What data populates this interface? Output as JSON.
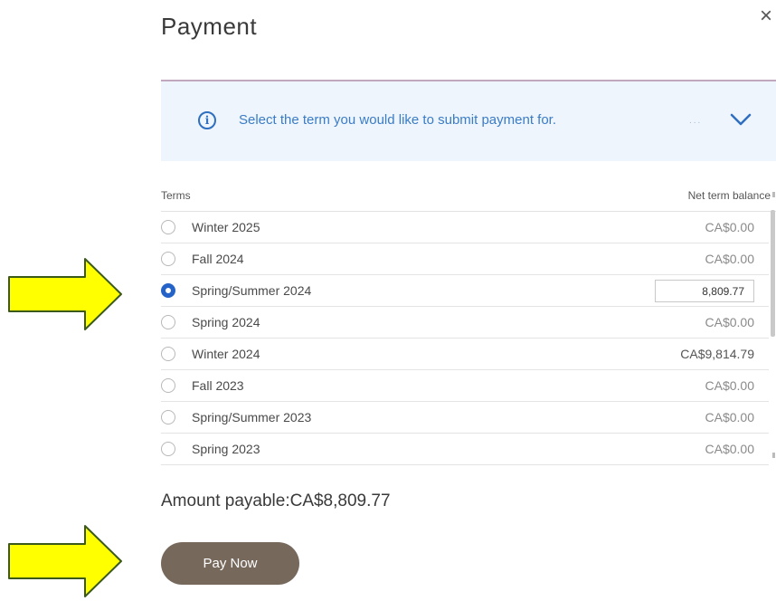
{
  "dialog": {
    "title": "Payment",
    "close_label": "×"
  },
  "info": {
    "message": "Select the term you would like to submit payment for.",
    "dots": "...",
    "icon": "info-circle-icon"
  },
  "table": {
    "headers": {
      "terms": "Terms",
      "balance": "Net term balance"
    },
    "rows": [
      {
        "term": "Winter 2025",
        "balance": "CA$0.00",
        "selected": false
      },
      {
        "term": "Fall 2024",
        "balance": "CA$0.00",
        "selected": false
      },
      {
        "term": "Spring/Summer 2024",
        "balance": "",
        "input_value": "8,809.77",
        "selected": true
      },
      {
        "term": "Spring 2024",
        "balance": "CA$0.00",
        "selected": false
      },
      {
        "term": "Winter 2024",
        "balance": "CA$9,814.79",
        "selected": false
      },
      {
        "term": "Fall 2023",
        "balance": "CA$0.00",
        "selected": false
      },
      {
        "term": "Spring/Summer 2023",
        "balance": "CA$0.00",
        "selected": false
      },
      {
        "term": "Spring 2023",
        "balance": "CA$0.00",
        "selected": false
      }
    ]
  },
  "summary": {
    "amount_payable": "Amount payable:CA$8,809.77"
  },
  "actions": {
    "pay_now": "Pay Now"
  },
  "colors": {
    "accent_blue": "#2563c9",
    "info_bg": "#eef5fc",
    "button_bg": "#77685c",
    "arrow_fill": "#ffff00",
    "arrow_stroke": "#3b5a1a"
  }
}
